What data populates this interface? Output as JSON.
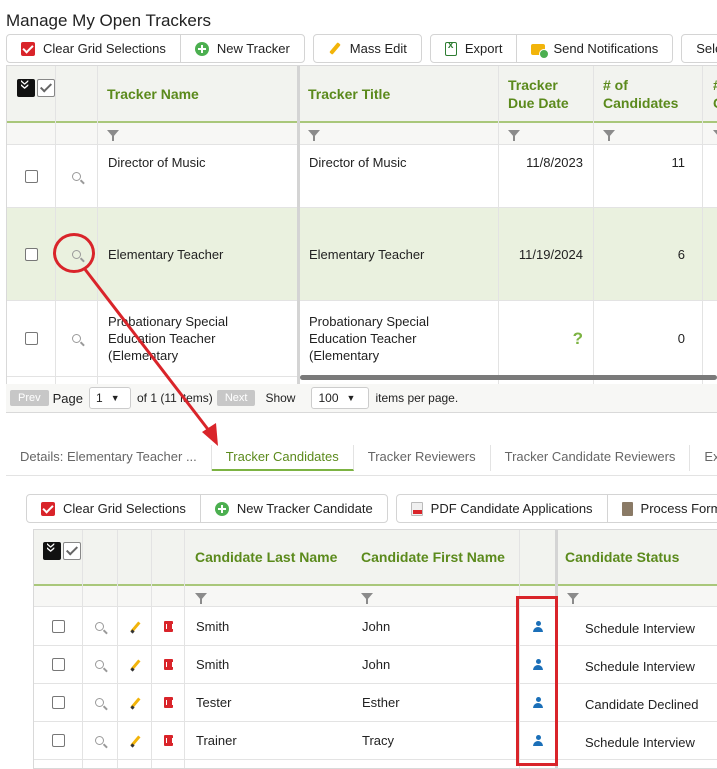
{
  "page_title": "Manage My Open Trackers",
  "top_toolbar": {
    "clear_grid": "Clear Grid Selections",
    "new_tracker": "New Tracker",
    "mass_edit": "Mass Edit",
    "export": "Export",
    "send_notifications": "Send Notifications",
    "select_partial": "Sele"
  },
  "tracker_grid": {
    "headers": {
      "name": "Tracker Name",
      "title": "Tracker Title",
      "due_date": "Tracker Due Date",
      "candidates": "# of Candidates",
      "next_partial_1": "#",
      "next_partial_2": "C"
    },
    "rows": [
      {
        "name": "Director of Music",
        "title": "Director of Music",
        "due": "11/8/2023",
        "count": "11"
      },
      {
        "name": "Elementary Teacher",
        "title": "Elementary Teacher",
        "due": "11/19/2024",
        "count": "6"
      },
      {
        "name": "Probationary Special Education Teacher (Elementary",
        "title": "Probationary Special Education Teacher (Elementary",
        "due": "?",
        "count": "0"
      }
    ]
  },
  "pager": {
    "prev": "Prev",
    "page_label": "Page",
    "page_value": "1",
    "of_text": "of 1 (11 items)",
    "next": "Next",
    "show_label": "Show",
    "size_value": "100",
    "per_page": "items per page."
  },
  "tabs": [
    {
      "label": "Details: Elementary Teacher ..."
    },
    {
      "label": "Tracker Candidates"
    },
    {
      "label": "Tracker Reviewers"
    },
    {
      "label": "Tracker Candidate Reviewers"
    },
    {
      "label": "Externa"
    }
  ],
  "candidate_toolbar": {
    "clear_grid": "Clear Grid Selections",
    "new_candidate": "New Tracker Candidate",
    "pdf_apps": "PDF Candidate Applications",
    "process_forms": "Process Form"
  },
  "candidate_grid": {
    "headers": {
      "last": "Candidate Last Name",
      "first": "Candidate First Name",
      "status": "Candidate Status"
    },
    "rows": [
      {
        "last": "Smith",
        "first": "John",
        "status": "Schedule Interview"
      },
      {
        "last": "Smith",
        "first": "John",
        "status": "Schedule Interview"
      },
      {
        "last": "Tester",
        "first": "Esther",
        "status": "Candidate Declined"
      },
      {
        "last": "Trainer",
        "first": "Tracy",
        "status": "Schedule Interview"
      }
    ]
  },
  "colors": {
    "accent_green": "#5b8a1c",
    "highlight_red": "#d9242a",
    "selected_row": "#eaf1df"
  }
}
